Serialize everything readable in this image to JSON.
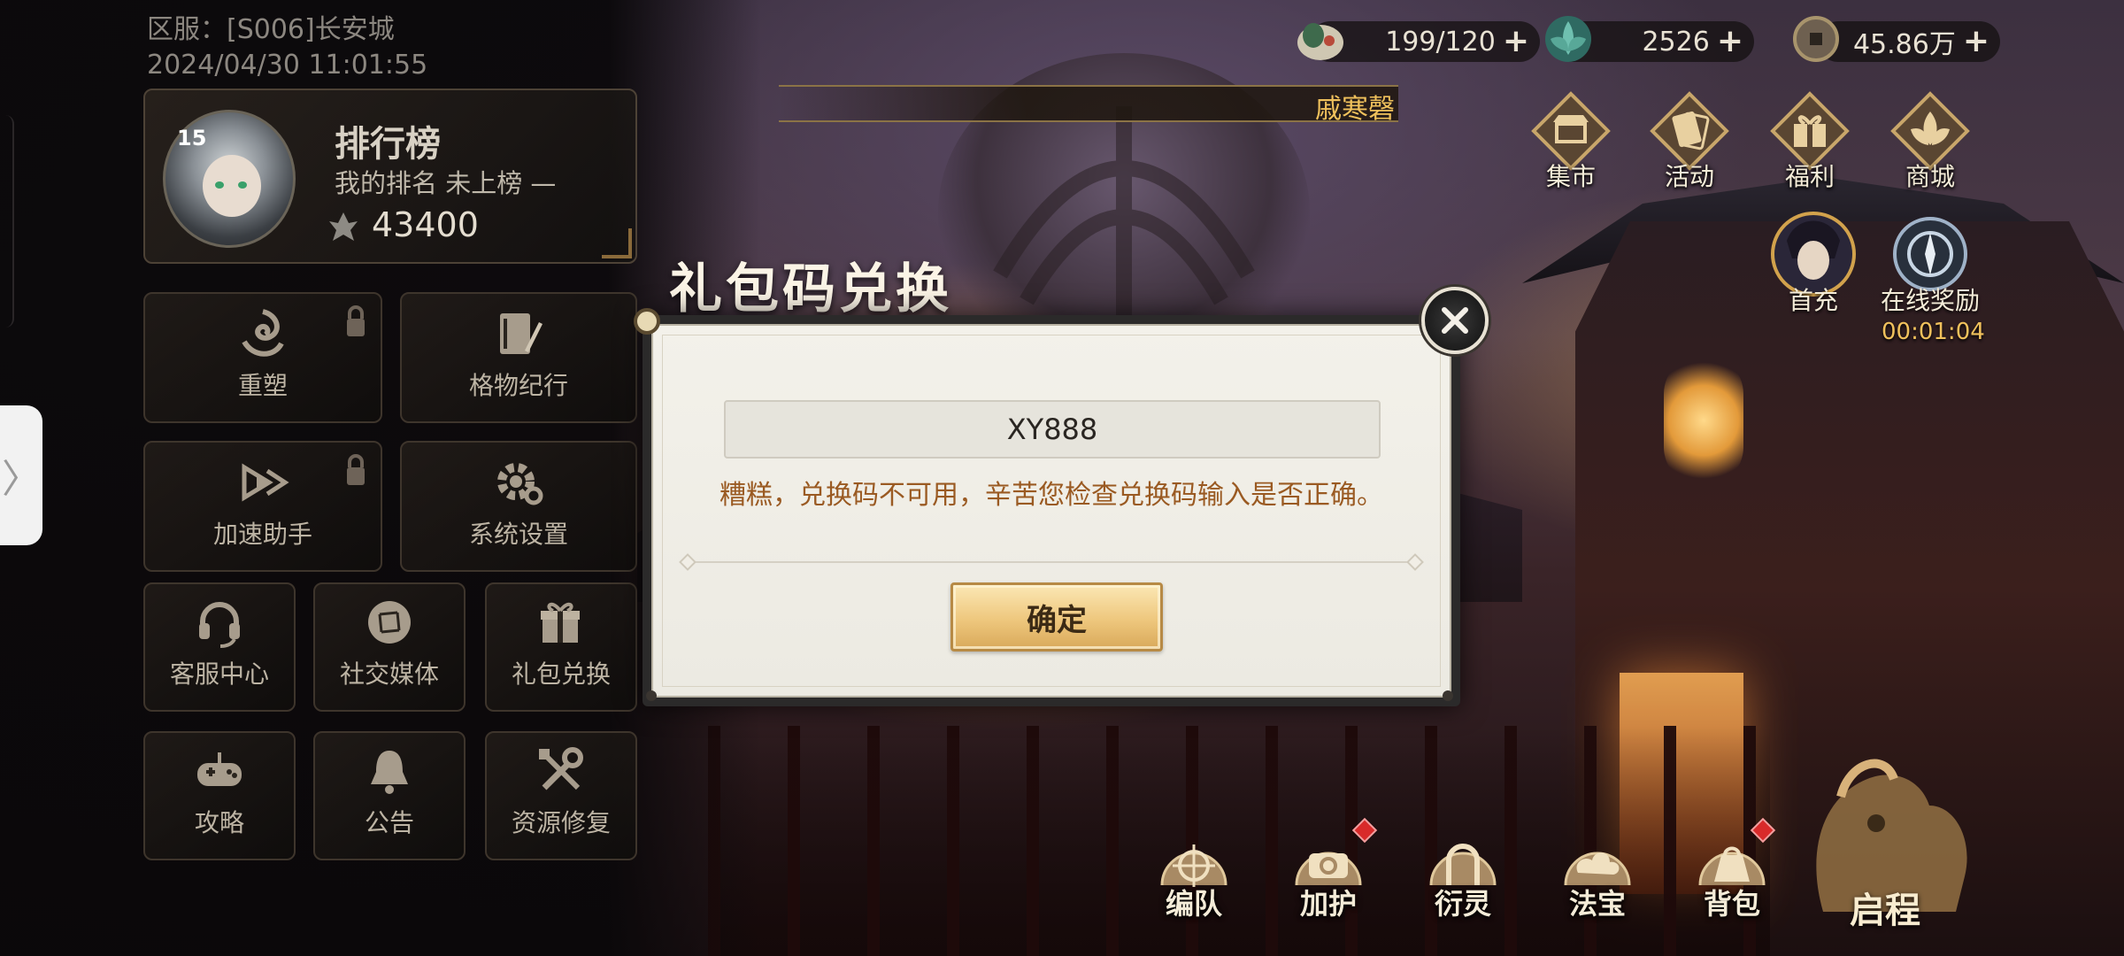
{
  "server": {
    "label": "区服：[S006]长安城",
    "datetime": "2024/04/30 11:01:55"
  },
  "ranking": {
    "level": "15",
    "title": "排行榜",
    "my_rank": "我的排名 未上榜 —",
    "power": "43400"
  },
  "menu": {
    "reshape": "重塑",
    "chronicle": "格物纪行",
    "accelerator": "加速助手",
    "settings": "系统设置",
    "customer_service": "客服中心",
    "social_media": "社交媒体",
    "gift_exchange": "礼包兑换",
    "guide": "攻略",
    "announcement": "公告",
    "resource_repair": "资源修复"
  },
  "resources": {
    "stamina": "199/120",
    "jade": "2526",
    "coins": "45.86万"
  },
  "player_banner": "戚寒磬",
  "top_buttons": {
    "market": "集市",
    "activity": "活动",
    "welfare": "福利",
    "shop": "商城",
    "first_recharge": "首充",
    "online_reward": "在线奖励",
    "online_timer": "00:01:04"
  },
  "bottom_nav": {
    "formation": "编队",
    "protect": "加护",
    "derive": "衍灵",
    "treasure": "法宝",
    "bag": "背包",
    "start": "启程"
  },
  "modal": {
    "title": "礼包码兑换",
    "code_value": "XY888",
    "error": "糟糕，兑换码不可用，辛苦您检查兑换码输入是否正确。",
    "confirm_label": "确定"
  },
  "side_handle_glyph": "〉",
  "colors": {
    "accent_gold": "#f0c15c",
    "error_text": "#9a5a22",
    "red_dot": "#d82a2a"
  }
}
